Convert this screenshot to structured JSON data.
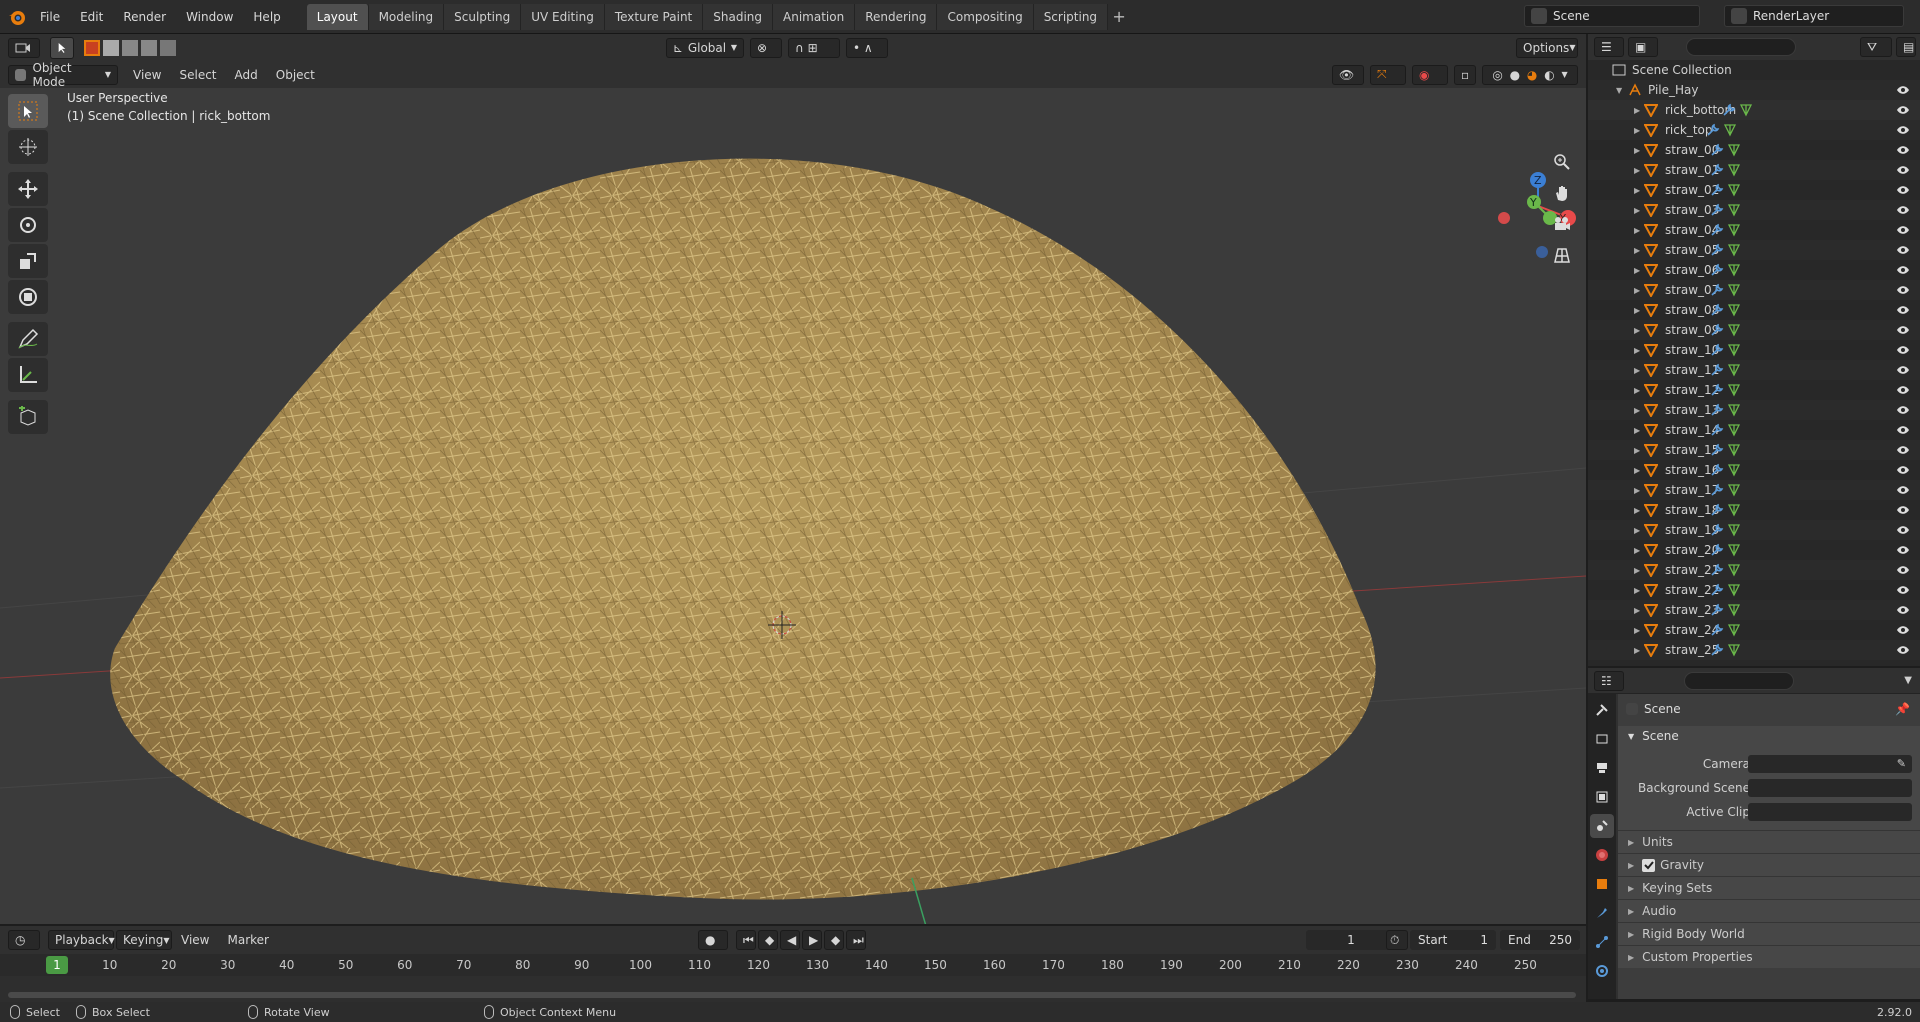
{
  "menu": [
    "File",
    "Edit",
    "Render",
    "Window",
    "Help"
  ],
  "workspaces": [
    "Layout",
    "Modeling",
    "Sculpting",
    "UV Editing",
    "Texture Paint",
    "Shading",
    "Animation",
    "Rendering",
    "Compositing",
    "Scripting"
  ],
  "active_workspace": "Layout",
  "scene_name": "Scene",
  "view_layer": "RenderLayer",
  "viewport": {
    "mode": "Object Mode",
    "menus": [
      "View",
      "Select",
      "Add",
      "Object"
    ],
    "transform_orientation": "Global",
    "options_label": "Options",
    "perspective_label": "User Perspective",
    "context_label": "(1) Scene Collection | rick_bottom",
    "gizmo": {
      "x": "X",
      "y": "Y",
      "z": "Z"
    }
  },
  "outliner": {
    "root": "Scene Collection",
    "collection": "Pile_Hay",
    "objects": [
      "rick_bottom",
      "rick_top",
      "straw_00",
      "straw_01",
      "straw_02",
      "straw_03",
      "straw_04",
      "straw_05",
      "straw_06",
      "straw_07",
      "straw_08",
      "straw_09",
      "straw_10",
      "straw_11",
      "straw_12",
      "straw_13",
      "straw_14",
      "straw_15",
      "straw_16",
      "straw_17",
      "straw_18",
      "straw_19",
      "straw_20",
      "straw_21",
      "straw_22",
      "straw_23",
      "straw_24",
      "straw_25"
    ]
  },
  "properties": {
    "context": "Scene",
    "panel": "Scene",
    "fields": [
      {
        "label": "Camera"
      },
      {
        "label": "Background Scene"
      },
      {
        "label": "Active Clip"
      }
    ],
    "collapsed_panels": [
      "Units",
      "Gravity",
      "Keying Sets",
      "Audio",
      "Rigid Body World",
      "Custom Properties"
    ],
    "gravity_checked": true
  },
  "timeline": {
    "menus": [
      "Playback",
      "Keying",
      "View",
      "Marker"
    ],
    "current_frame": "1",
    "start_label": "Start",
    "start": "1",
    "end_label": "End",
    "end": "250",
    "ruler": [
      "1",
      "10",
      "20",
      "30",
      "40",
      "50",
      "60",
      "70",
      "80",
      "90",
      "100",
      "110",
      "120",
      "130",
      "140",
      "150",
      "160",
      "170",
      "180",
      "190",
      "200",
      "210",
      "220",
      "230",
      "240",
      "250"
    ]
  },
  "statusbar": {
    "select": "Select",
    "box_select": "Box Select",
    "rotate_view": "Rotate View",
    "context_menu": "Object Context Menu",
    "version": "2.92.0"
  },
  "colors": {
    "accent": "#e87d0d",
    "timeline_cursor": "#4a9a44",
    "hay": "#c8a865"
  }
}
